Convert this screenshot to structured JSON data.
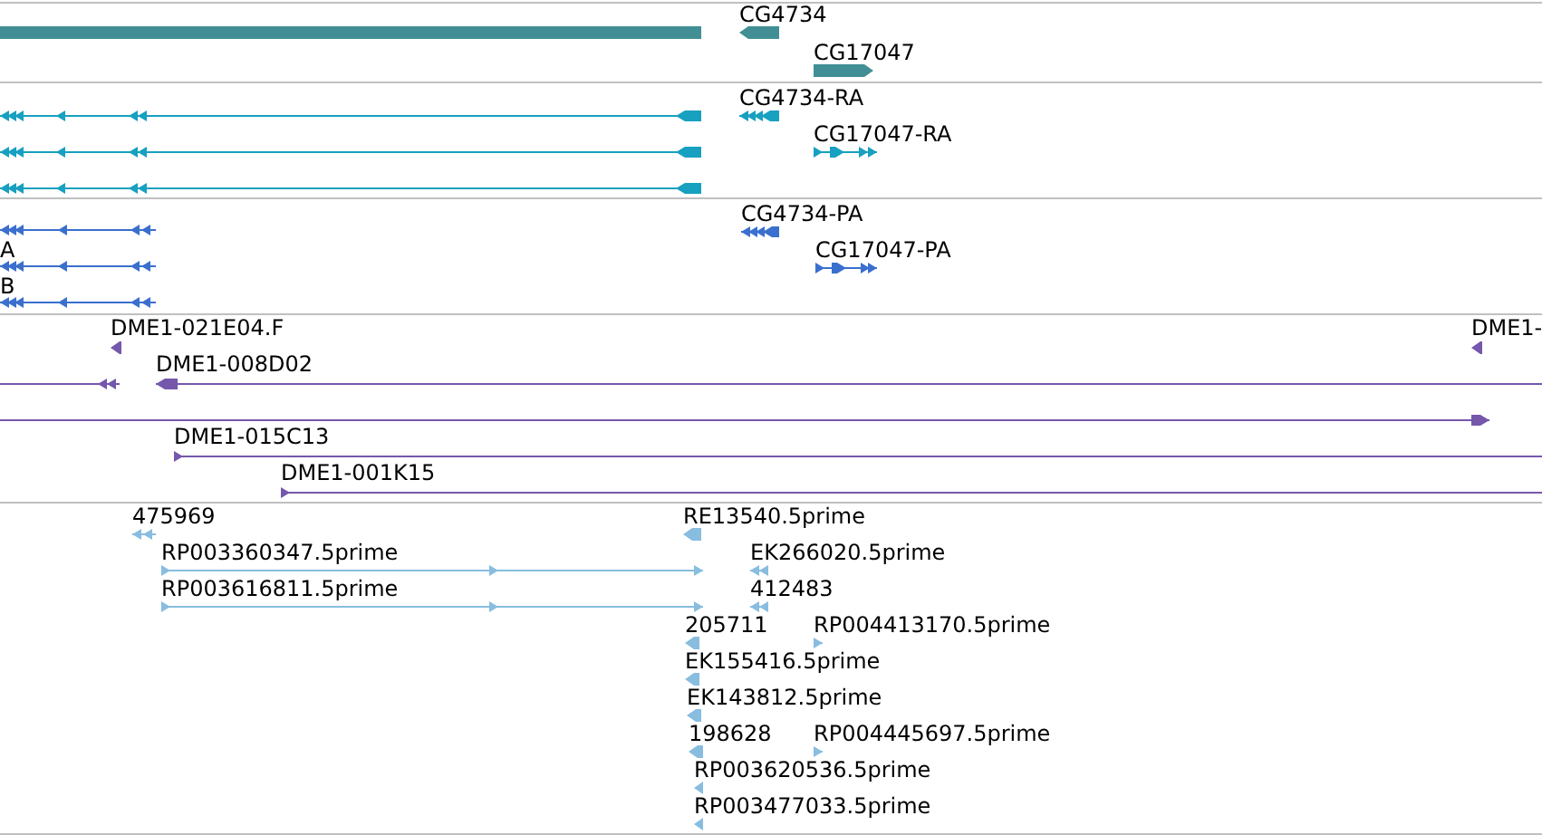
{
  "tracks": [
    {
      "color": "#418f94",
      "features": [
        {
          "kind": "bar",
          "reverse": true
        },
        {
          "label": "CG4734",
          "kind": "bar",
          "reverse": true
        },
        {
          "label": "CG17047",
          "kind": "bar",
          "reverse": false
        }
      ]
    },
    {
      "color": "#17a0c0",
      "features": [
        {
          "kind": "line",
          "reverse": true
        },
        {
          "kind": "line",
          "reverse": true
        },
        {
          "kind": "line",
          "reverse": true
        },
        {
          "label": "CG4734-RA",
          "kind": "line",
          "reverse": true
        },
        {
          "label": "CG17047-RA",
          "kind": "line",
          "reverse": false
        }
      ]
    },
    {
      "color": "#3a6fce",
      "features": [
        {
          "kind": "line",
          "reverse": true
        },
        {
          "label": "A",
          "kind": "line",
          "reverse": true
        },
        {
          "label": "B",
          "kind": "line",
          "reverse": true
        },
        {
          "label": "CG4734-PA",
          "kind": "line",
          "reverse": true
        },
        {
          "label": "CG17047-PA",
          "kind": "line",
          "reverse": false
        }
      ]
    },
    {
      "color": "#7557ac",
      "features": [
        {
          "label": "DME1-021E04.F",
          "kind": "bar",
          "reverse": true
        },
        {
          "label": "DME1-",
          "kind": "bar",
          "reverse": true
        },
        {
          "kind": "line",
          "reverse": true
        },
        {
          "label": "DME1-008D02",
          "kind": "line",
          "reverse": true
        },
        {
          "kind": "line",
          "reverse": false
        },
        {
          "label": "DME1-015C13",
          "kind": "line",
          "reverse": false
        },
        {
          "label": "DME1-001K15",
          "kind": "line",
          "reverse": false
        }
      ]
    },
    {
      "color": "#88bde0",
      "features": [
        {
          "label": "475969",
          "kind": "line",
          "reverse": true
        },
        {
          "label": "RE13540.5prime",
          "kind": "bar",
          "reverse": true
        },
        {
          "label": "RP003360347.5prime",
          "kind": "line",
          "reverse": false
        },
        {
          "label": "EK266020.5prime",
          "kind": "line",
          "reverse": true
        },
        {
          "label": "RP003616811.5prime",
          "kind": "line",
          "reverse": false
        },
        {
          "label": "412483",
          "kind": "line",
          "reverse": true
        },
        {
          "label": "205711",
          "kind": "bar",
          "reverse": true
        },
        {
          "label": "RP004413170.5prime",
          "kind": "line",
          "reverse": false
        },
        {
          "label": "EK155416.5prime",
          "kind": "bar",
          "reverse": true
        },
        {
          "label": "EK143812.5prime",
          "kind": "bar",
          "reverse": true
        },
        {
          "label": "198628",
          "kind": "bar",
          "reverse": true
        },
        {
          "label": "RP004445697.5prime",
          "kind": "line",
          "reverse": false
        },
        {
          "label": "RP003620536.5prime",
          "kind": "bar",
          "reverse": true
        },
        {
          "label": "RP003477033.5prime",
          "kind": "bar",
          "reverse": true
        }
      ]
    }
  ]
}
